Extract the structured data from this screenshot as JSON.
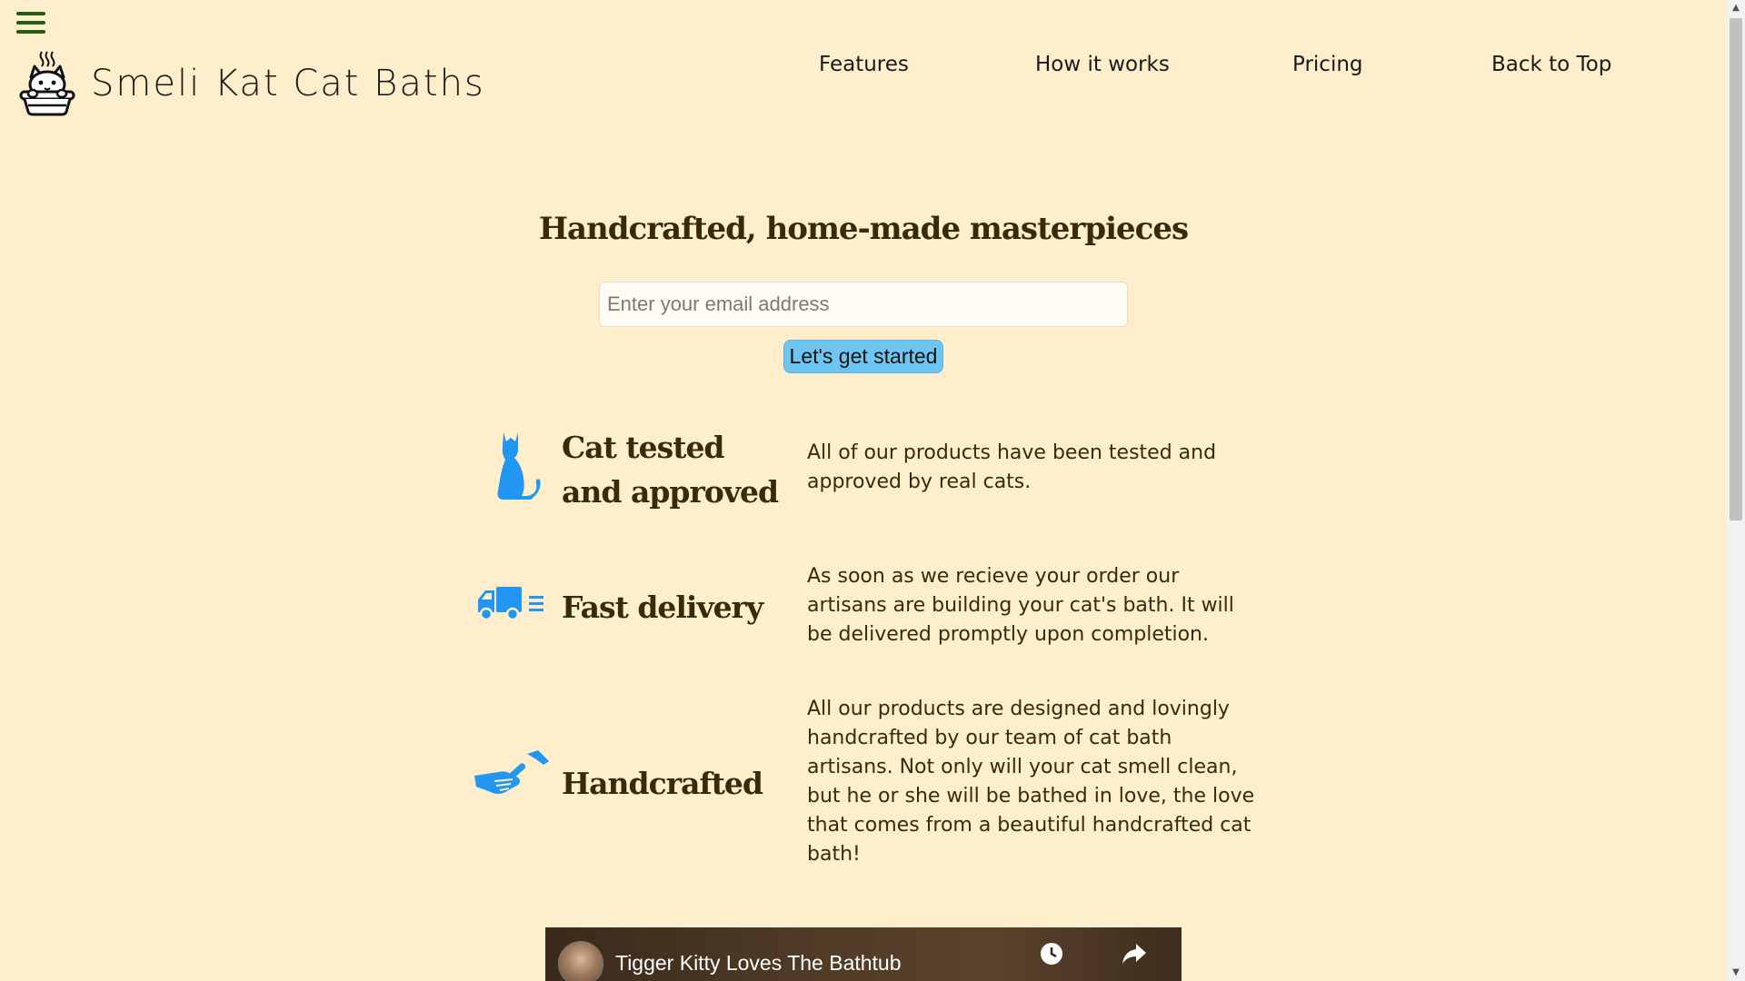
{
  "header": {
    "menu_icon": "hamburger-menu-icon",
    "logo_icon": "cat-in-bathtub-icon",
    "brand_name": "Smeli Kat Cat Baths"
  },
  "nav": {
    "items": [
      {
        "label": "Features"
      },
      {
        "label": "How it works"
      },
      {
        "label": "Pricing"
      },
      {
        "label": "Back to Top"
      }
    ]
  },
  "hero": {
    "title": "Handcrafted, home-made masterpieces",
    "email_placeholder": "Enter your email address",
    "email_value": "",
    "cta_label": "Let's get started"
  },
  "features": [
    {
      "icon": "cat-icon",
      "title": "Cat tested and approved",
      "description": "All of our products have been tested and approved by real cats."
    },
    {
      "icon": "delivery-truck-icon",
      "title": "Fast delivery",
      "description": "As soon as we recieve your order our artisans are building your cat's bath. It will be delivered promptly upon completion."
    },
    {
      "icon": "handshake-hammer-icon",
      "title": "Handcrafted",
      "description": "All our products are designed and lovingly handcrafted by our team of cat bath artisans. Not only will your cat smell clean, but he or she will be bathed in love, the love that comes from a beautiful handcrafted cat bath!"
    }
  ],
  "video": {
    "title": "Tigger Kitty Loves The Bathtub",
    "watch_later_icon": "clock-icon",
    "share_icon": "share-arrow-icon"
  },
  "colors": {
    "background": "#FFEECB",
    "accent_blue": "#2196F3",
    "button_blue": "#6EC5F2",
    "heading_brown": "#3B2A0A",
    "menu_green": "#1F5E14"
  }
}
